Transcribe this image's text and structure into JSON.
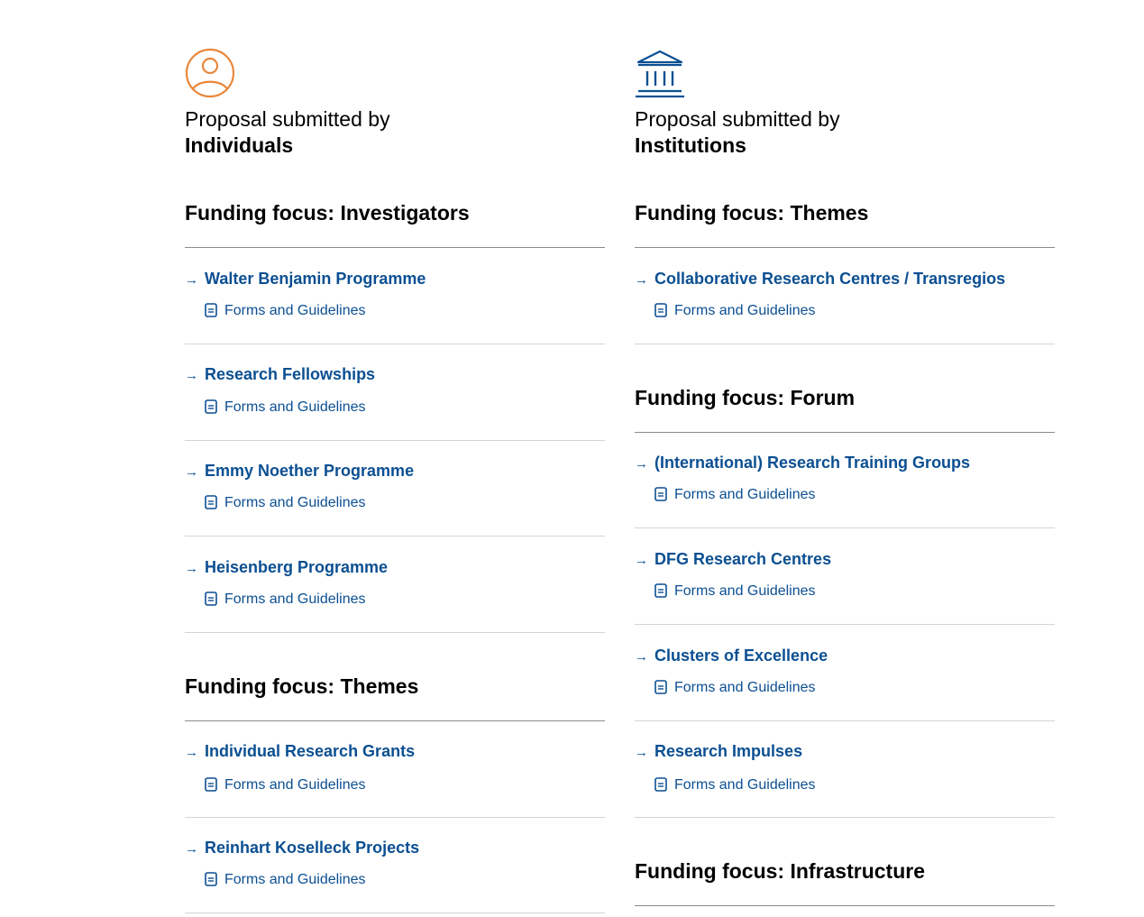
{
  "left": {
    "intro": "Proposal submitted by",
    "audience": "Individuals",
    "icon": "person-icon",
    "accent": "#e8873a",
    "sections": [
      {
        "heading": "Funding focus: Investigators",
        "entries": [
          {
            "title": "Walter Benjamin Programme",
            "forms": "Forms and Guidelines"
          },
          {
            "title": "Research Fellowships",
            "forms": "Forms and Guidelines"
          },
          {
            "title": "Emmy Noether Programme",
            "forms": "Forms and Guidelines"
          },
          {
            "title": "Heisenberg Programme",
            "forms": "Forms and Guidelines"
          }
        ]
      },
      {
        "heading": "Funding focus: Themes",
        "entries": [
          {
            "title": "Individual Research Grants",
            "forms": "Forms and Guidelines"
          },
          {
            "title": "Reinhart Koselleck Projects",
            "forms": "Forms and Guidelines"
          }
        ]
      }
    ]
  },
  "right": {
    "intro": "Proposal submitted by",
    "audience": "Institutions",
    "icon": "institution-icon",
    "accent": "#0b4f92",
    "sections": [
      {
        "heading": "Funding focus: Themes",
        "entries": [
          {
            "title": "Collaborative Research Centres / Transregios",
            "forms": "Forms and Guidelines"
          }
        ]
      },
      {
        "heading": "Funding focus: Forum",
        "entries": [
          {
            "title": "(International) Research Training Groups",
            "forms": "Forms and Guidelines"
          },
          {
            "title": "DFG Research Centres",
            "forms": "Forms and Guidelines"
          },
          {
            "title": "Clusters of Excellence",
            "forms": "Forms and Guidelines"
          },
          {
            "title": "Research Impulses",
            "forms": "Forms and Guidelines"
          }
        ]
      },
      {
        "heading": "Funding focus: Infrastructure",
        "entries": []
      }
    ]
  },
  "colors": {
    "link": "#0b4f92",
    "rule": "#d4d4d4",
    "heading_rule": "#8a8a8a"
  }
}
